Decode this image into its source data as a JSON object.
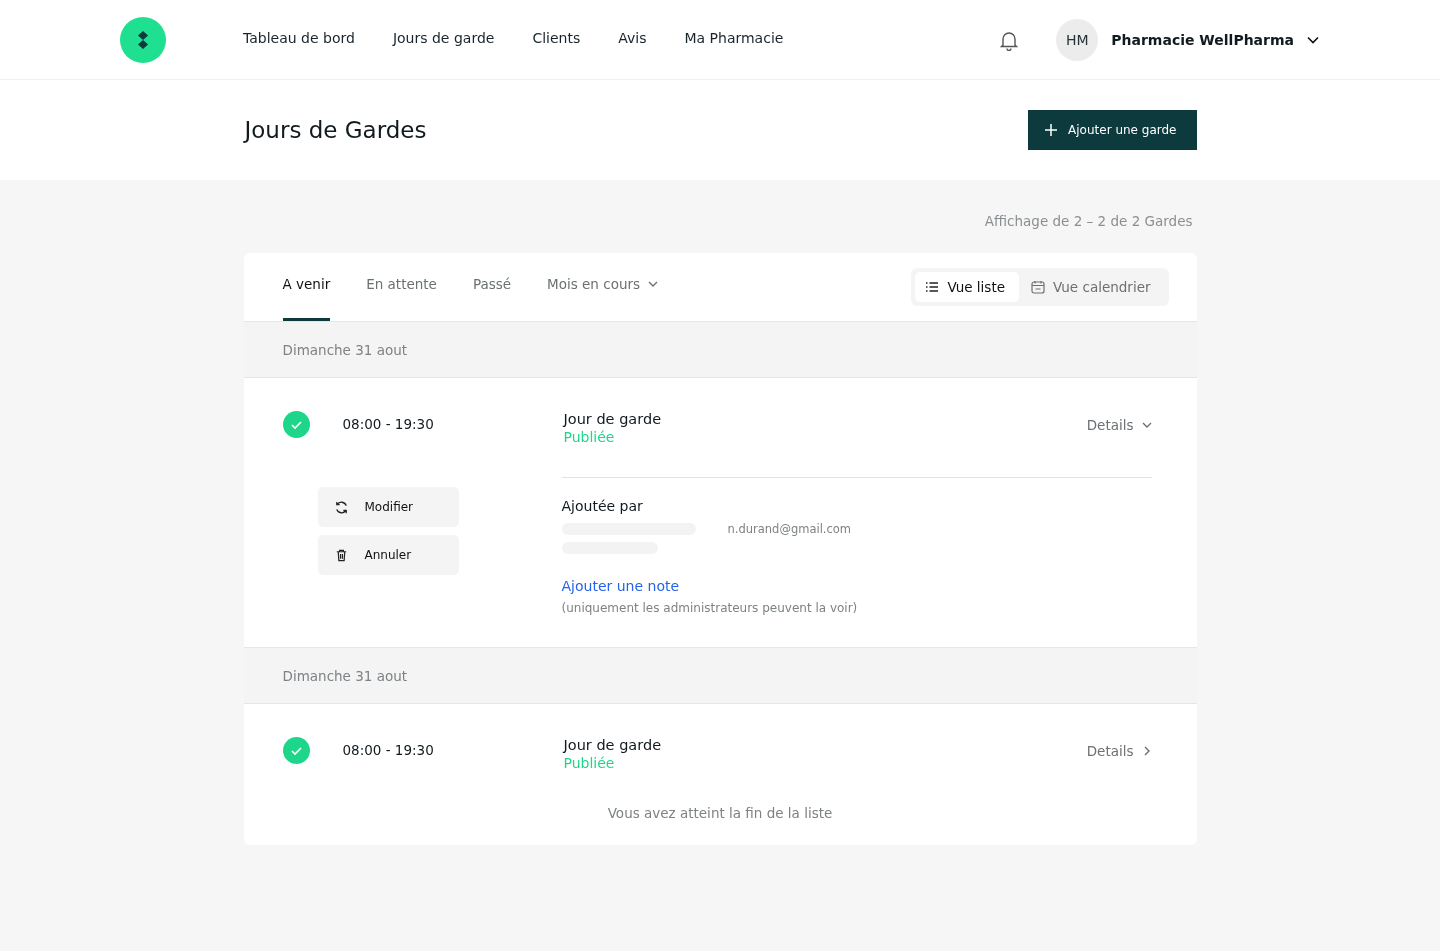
{
  "nav": {
    "items": [
      {
        "label": "Tableau de bord",
        "selected": false
      },
      {
        "label": "Jours de garde",
        "selected": false
      },
      {
        "label": "Clients",
        "selected": false
      },
      {
        "label": "Avis",
        "selected": false
      },
      {
        "label": "Ma Pharmacie",
        "selected": false
      }
    ],
    "user": {
      "initials": "HM",
      "name": "Pharmacie WellPharma"
    }
  },
  "page": {
    "title": "Jours de Gardes",
    "add_button": "Ajouter une garde"
  },
  "counter": "Affichage de 2 – 2 de 2 Gardes",
  "tabs": [
    {
      "label": "A venir",
      "selected": true,
      "kind": "tab"
    },
    {
      "label": "En attente",
      "selected": false,
      "kind": "tab"
    },
    {
      "label": "Passé",
      "selected": false,
      "kind": "tab"
    },
    {
      "label": "Mois en cours",
      "selected": false,
      "kind": "dropdown"
    }
  ],
  "views": [
    {
      "label": "Vue liste",
      "selected": true,
      "kind": "list"
    },
    {
      "label": "Vue calendrier",
      "selected": false,
      "kind": "calendar"
    }
  ],
  "groups": [
    {
      "date": "Dimanche 31 aout",
      "entry": {
        "time": "08:00 - 19:30",
        "title": "Jour de garde",
        "status": "Publiée",
        "details_label": "Details",
        "expanded": true,
        "actions": [
          {
            "label": "Modifier",
            "kind": "edit"
          },
          {
            "label": "Annuler",
            "kind": "delete"
          }
        ],
        "added_by_label": "Ajoutée par",
        "email": "n.durand@gmail.com",
        "add_note": "Ajouter une note",
        "note_hint": "(uniquement les administrateurs peuvent la voir)"
      }
    },
    {
      "date": "Dimanche 31 aout",
      "entry": {
        "time": "08:00 - 19:30",
        "title": "Jour de garde",
        "status": "Publiée",
        "details_label": "Details",
        "expanded": false
      }
    }
  ],
  "end_message": "Vous avez atteint la fin de la liste"
}
